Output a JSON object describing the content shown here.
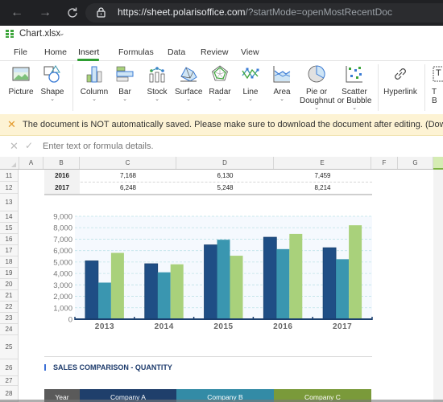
{
  "browser": {
    "url_host": "https://sheet.polarisoffice.com",
    "url_path": "/?startMode=openMostRecentDoc",
    "icons": [
      "back-arrow-icon",
      "forward-arrow-icon",
      "reload-icon",
      "lock-icon"
    ]
  },
  "app": {
    "file_name": "Chart.xlsx",
    "file_menu_chevron": "⌄"
  },
  "tabs": [
    {
      "label": "File",
      "active": false
    },
    {
      "label": "Home",
      "active": false
    },
    {
      "label": "Insert",
      "active": true
    },
    {
      "label": "Formulas",
      "active": false
    },
    {
      "label": "Data",
      "active": false
    },
    {
      "label": "Review",
      "active": false
    },
    {
      "label": "View",
      "active": false
    }
  ],
  "ribbon": {
    "picture": "Picture",
    "shape": "Shape",
    "column": "Column",
    "bar": "Bar",
    "stock": "Stock",
    "surface": "Surface",
    "radar": "Radar",
    "line": "Line",
    "area": "Area",
    "pie_1": "Pie or",
    "pie_2": "Doughnut",
    "scatter_1": "Scatter",
    "scatter_2": "or Bubble",
    "hyperlink": "Hyperlink",
    "textbox_1": "T",
    "textbox_2": "B",
    "chev": "⌄"
  },
  "notice": {
    "text": "The document is NOT automatically saved. Please make sure to download the document after editing. (Downlo"
  },
  "formula_bar": {
    "placeholder": "Enter text or formula details."
  },
  "columns": [
    "A",
    "B",
    "C",
    "D",
    "E",
    "F",
    "G"
  ],
  "rows": [
    "11",
    "12",
    "13",
    "14",
    "15",
    "16",
    "17",
    "18",
    "19",
    "20",
    "21",
    "22",
    "23",
    "24",
    "25",
    "26",
    "27",
    "28"
  ],
  "table_rows": [
    {
      "year": "2016",
      "a": "7,168",
      "b": "6,130",
      "c": "7,459"
    },
    {
      "year": "2017",
      "a": "6,248",
      "b": "5,248",
      "c": "8,214"
    }
  ],
  "section": {
    "title": "SALES COMPARISON - QUANTITY",
    "headers": [
      "Year",
      "Company A",
      "Company B",
      "Company C"
    ]
  },
  "colors": {
    "company_a": "#1f4e85",
    "company_b": "#3a96b0",
    "company_c": "#a9d17b",
    "accent_green": "#2e9e32",
    "notice_bg": "#fdf3d4"
  },
  "chart_data": {
    "type": "bar",
    "title": "",
    "xlabel": "",
    "ylabel": "",
    "categories": [
      "2013",
      "2014",
      "2015",
      "2016",
      "2017"
    ],
    "series": [
      {
        "name": "Company A",
        "color": "#1f4e85",
        "values": [
          5100,
          4850,
          6500,
          7168,
          6248
        ]
      },
      {
        "name": "Company B",
        "color": "#3a96b0",
        "values": [
          3200,
          4100,
          6950,
          6130,
          5248
        ]
      },
      {
        "name": "Company C",
        "color": "#a9d17b",
        "values": [
          5800,
          4800,
          5550,
          7459,
          8214
        ]
      }
    ],
    "ylim": [
      0,
      9000
    ],
    "yticks": [
      0,
      1000,
      2000,
      3000,
      4000,
      5000,
      6000,
      7000,
      8000,
      9000
    ],
    "ytick_labels": [
      "0",
      "1,000",
      "2,000",
      "3,000",
      "4,000",
      "5,000",
      "6,000",
      "7,000",
      "8,000",
      "9,000"
    ],
    "grid": true,
    "legend": "none"
  }
}
